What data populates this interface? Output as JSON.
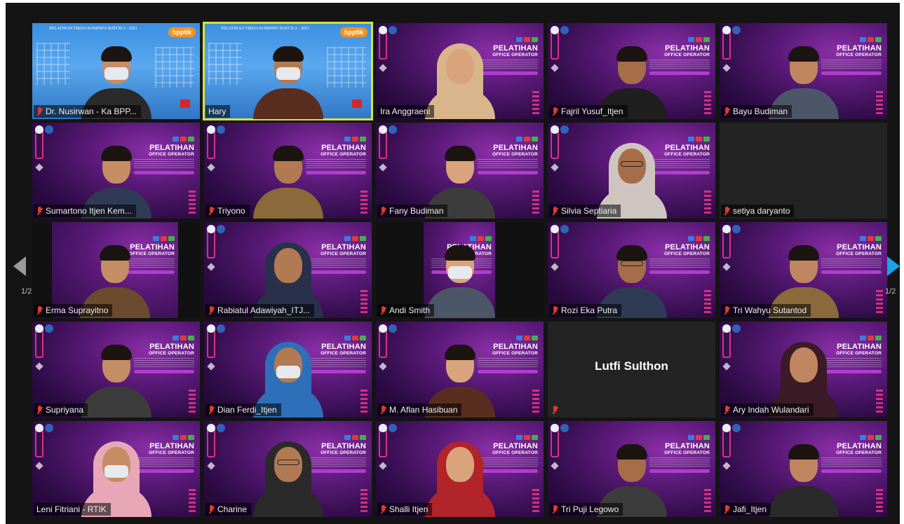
{
  "meeting": {
    "page_indicator": "1/2",
    "colors": {
      "active_speaker_outline": "#d9e23a",
      "mute_icon": "#e0392f",
      "next_arrow": "#1aa3e8",
      "prev_arrow": "#9a9a9a",
      "tile_background": "#232323"
    }
  },
  "banner": {
    "title": "PELATIHAN",
    "subtitle": "OFFICE OPERATOR",
    "blue_header": "PELATIHAN TIKDA KOMINFO BATCH-2 - 2021",
    "bpptik_label": "bpptik"
  },
  "participants": [
    {
      "name": "Dr. Nusirwan - Ka BPP...",
      "bg": "blue",
      "muted": true
    },
    {
      "name": "Hary",
      "bg": "blue",
      "muted": false,
      "active": true
    },
    {
      "name": "Ira Anggraeni",
      "bg": "purple",
      "muted": false
    },
    {
      "name": "Fajril Yusuf_Itjen",
      "bg": "purple",
      "muted": true
    },
    {
      "name": "Bayu Budiman",
      "bg": "purple",
      "muted": true
    },
    {
      "name": "Sumartono Itjen Kem...",
      "bg": "purple",
      "muted": true
    },
    {
      "name": "Triyono",
      "bg": "purple",
      "muted": true
    },
    {
      "name": "Fany Budiman",
      "bg": "purple",
      "muted": true
    },
    {
      "name": "Silvia Septiaria",
      "bg": "purple",
      "muted": true
    },
    {
      "name": "setiya daryanto",
      "bg": "dark",
      "muted": true
    },
    {
      "name": "Erma Suprayitno",
      "bg": "black-inset",
      "muted": true
    },
    {
      "name": "Rabiatul Adawiyah_ITJ...",
      "bg": "purple",
      "muted": true
    },
    {
      "name": "Andi Smith",
      "bg": "black-inset",
      "muted": true
    },
    {
      "name": "Rozi Eka Putra",
      "bg": "purple",
      "muted": true
    },
    {
      "name": "Tri Wahyu Sutantod",
      "bg": "purple",
      "muted": true
    },
    {
      "name": "Supriyana",
      "bg": "purple",
      "muted": true
    },
    {
      "name": "Dian Ferdi_Itjen",
      "bg": "purple",
      "muted": true
    },
    {
      "name": "M. Aflan Hasibuan",
      "bg": "purple",
      "muted": true
    },
    {
      "name": "Lutfi Sulthon",
      "bg": "dark",
      "muted": true,
      "video_off": true
    },
    {
      "name": "Ary Indah Wulandari",
      "bg": "purple",
      "muted": true
    },
    {
      "name": "Leni Fitriani - RTIK",
      "bg": "purple",
      "muted": false
    },
    {
      "name": "Charine",
      "bg": "purple",
      "muted": true
    },
    {
      "name": "Shalli Itjen",
      "bg": "purple",
      "muted": true
    },
    {
      "name": "Tri Puji Legowo",
      "bg": "purple",
      "muted": true
    },
    {
      "name": "Jafi_Itjen",
      "bg": "purple",
      "muted": true
    }
  ]
}
